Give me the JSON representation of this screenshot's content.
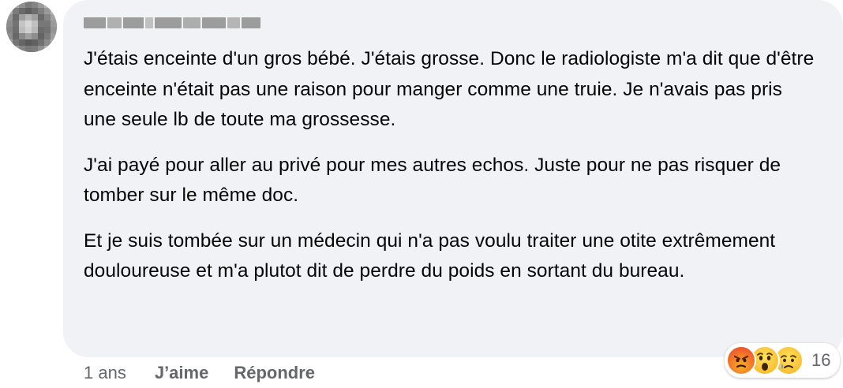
{
  "comment": {
    "author_name": "",
    "paragraphs": [
      "J'étais enceinte d'un gros bébé. J'étais grosse. Donc le radiologiste m'a dit que d'être enceinte n'était pas une raison pour manger comme une truie. Je n'avais pas pris une seule lb de toute ma grossesse.",
      "J'ai payé pour aller au privé pour mes autres echos. Juste pour ne pas risquer de tomber sur le même doc.",
      "Et je suis tombée sur un médecin qui n'a pas voulu traiter une otite extrêmement douloureuse et m'a plutot dit de perdre du poids en sortant du bureau."
    ],
    "reactions": {
      "icons": [
        "angry-icon",
        "wow-icon",
        "sad-icon"
      ],
      "count": "16"
    },
    "actions": {
      "time": "1 ans",
      "like_label": "J’aime",
      "reply_label": "Répondre"
    }
  }
}
